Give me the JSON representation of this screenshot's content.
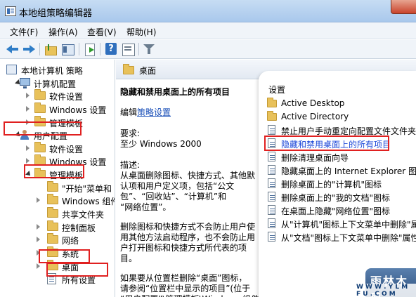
{
  "window": {
    "title": "本地组策略编辑器"
  },
  "menu": [
    "文件(F)",
    "操作(A)",
    "查看(V)",
    "帮助(H)"
  ],
  "toolbar": {
    "icons": [
      "back-arrow-icon",
      "forward-arrow-icon",
      "up-folder-icon",
      "show-hide-tree-icon",
      "export-list-icon",
      "help-icon",
      "properties-icon",
      "filter-icon"
    ]
  },
  "tree": [
    {
      "label": "本地计算机 策略",
      "level": 0,
      "icon": "policy",
      "twisty": "none"
    },
    {
      "label": "计算机配置",
      "level": 1,
      "icon": "computer",
      "twisty": "expanded"
    },
    {
      "label": "软件设置",
      "level": 2,
      "icon": "folder",
      "twisty": "collapsed"
    },
    {
      "label": "Windows 设置",
      "level": 2,
      "icon": "folder",
      "twisty": "collapsed"
    },
    {
      "label": "管理模板",
      "level": 2,
      "icon": "folder",
      "twisty": "collapsed"
    },
    {
      "label": "用户配置",
      "level": 1,
      "icon": "user",
      "twisty": "expanded"
    },
    {
      "label": "软件设置",
      "level": 2,
      "icon": "folder",
      "twisty": "collapsed"
    },
    {
      "label": "Windows 设置",
      "level": 2,
      "icon": "folder",
      "twisty": "collapsed"
    },
    {
      "label": "管理模板",
      "level": 2,
      "icon": "folder",
      "twisty": "expanded"
    },
    {
      "label": "\"开始\"菜单和",
      "level": 3,
      "icon": "folder",
      "twisty": "none"
    },
    {
      "label": "Windows 组件",
      "level": 3,
      "icon": "folder",
      "twisty": "collapsed"
    },
    {
      "label": "共享文件夹",
      "level": 3,
      "icon": "folder",
      "twisty": "none"
    },
    {
      "label": "控制面板",
      "level": 3,
      "icon": "folder",
      "twisty": "collapsed"
    },
    {
      "label": "网络",
      "level": 3,
      "icon": "folder",
      "twisty": "collapsed"
    },
    {
      "label": "系统",
      "level": 3,
      "icon": "folder",
      "twisty": "collapsed"
    },
    {
      "label": "桌面",
      "level": 3,
      "icon": "folder",
      "twisty": "collapsed"
    },
    {
      "label": "所有设置",
      "level": 3,
      "icon": "doc",
      "twisty": "none"
    }
  ],
  "middle": {
    "header": "桌面",
    "policy_title": "隐藏和禁用桌面上的所有项目",
    "edit_prefix": "编辑",
    "edit_link": "策略设置",
    "requirement_label": "要求:",
    "requirement_value": "至少 Windows 2000",
    "description_label": "描述:",
    "description_lines": [
      "从桌面删除图标、快捷方式、其他默",
      "认项和用户定义项，包括“公文",
      "包”、“回收站”、“计算机”和",
      "“网络位置”。",
      "",
      "删除图标和快捷方式不会防止用户使",
      "用其他方法启动程序，也不会防止用",
      "户打开图标和快捷方式所代表的项",
      "目。",
      "",
      "如果要从位置栏删除“桌面”图标，",
      "请参阅“位置栏中显示的项目”(位于",
      "“用户配置”\\管理模板\\Windows 组件"
    ]
  },
  "settings": {
    "header": "设置",
    "items": [
      {
        "label": "Active Desktop",
        "type": "folder",
        "selected": false
      },
      {
        "label": "Active Directory",
        "type": "folder",
        "selected": false
      },
      {
        "label": "禁止用户手动重定向配置文件文件夹",
        "type": "policy",
        "selected": false
      },
      {
        "label": "隐藏和禁用桌面上的所有项目",
        "type": "policy",
        "selected": true
      },
      {
        "label": "删除清理桌面向导",
        "type": "policy",
        "selected": false
      },
      {
        "label": "隐藏桌面上的 Internet Explorer 图标",
        "type": "policy",
        "selected": false
      },
      {
        "label": "删除桌面上的\"计算机\"图标",
        "type": "policy",
        "selected": false
      },
      {
        "label": "删除桌面上的\"我的文档\"图标",
        "type": "policy",
        "selected": false
      },
      {
        "label": "在桌面上隐藏\"网络位置\"图标",
        "type": "policy",
        "selected": false
      },
      {
        "label": "从\"计算机\"图标上下文菜单中删除\"属",
        "type": "policy",
        "selected": false
      },
      {
        "label": "从\"文档\"图标上下文菜单中删除\"属性",
        "type": "policy",
        "selected": false
      }
    ]
  },
  "watermark": {
    "title": "雨林木风",
    "url": "W W W . Y L M F U . C O M"
  },
  "colors": {
    "highlight_box": "#e02020",
    "link": "#1a4fb8",
    "selected_text": "#1a46d8"
  }
}
